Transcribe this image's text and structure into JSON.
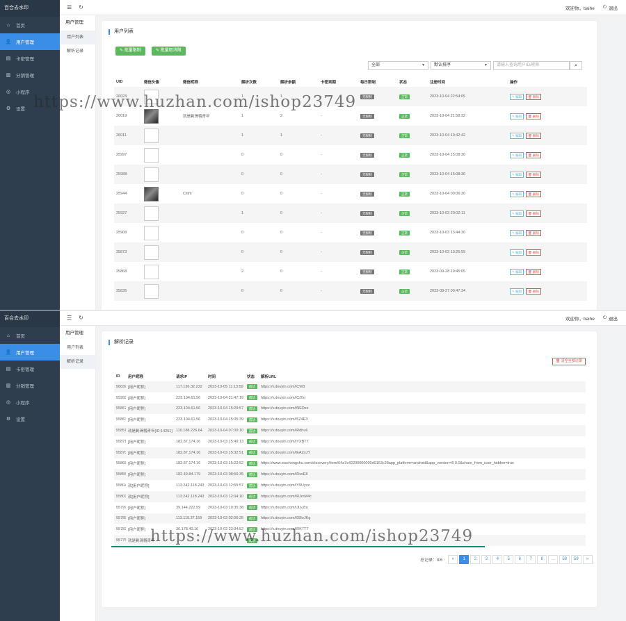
{
  "app": {
    "brand": "百合去水印"
  },
  "sidebar": {
    "items": [
      {
        "label": "首页",
        "icon": "home-icon"
      },
      {
        "label": "用户管理",
        "icon": "user-icon"
      },
      {
        "label": "卡密管理",
        "icon": "card-icon"
      },
      {
        "label": "分销管理",
        "icon": "stats-icon"
      },
      {
        "label": "小程序",
        "icon": "miniapp-icon"
      },
      {
        "label": "设置",
        "icon": "gear-icon"
      }
    ],
    "active": "用户管理"
  },
  "topbar": {
    "welcome": "欢迎你，baihe",
    "logout": "退出"
  },
  "subnav": {
    "title": "用户管理",
    "items": [
      "用户列表",
      "解析记录"
    ]
  },
  "user_list": {
    "title": "用户列表",
    "buttons": {
      "batch_limit": "批量限制",
      "batch_unlimit": "批量取消限"
    },
    "filters": {
      "status_select": "全部",
      "sort_select": "默认排序",
      "search_placeholder": "请输入查询用户ID/昵称",
      "search_icon": "search-icon"
    },
    "columns": [
      "UID",
      "微信头像",
      "微信昵称",
      "解析次数",
      "解析余额",
      "卡密到期",
      "每日限制",
      "状态",
      "注册时间",
      "操作"
    ],
    "rows": [
      {
        "uid": "26023",
        "avatar": "blank",
        "nickname": "",
        "count": "1",
        "balance": "1",
        "card_expire": "-",
        "limit": "无限制",
        "status": "正常",
        "reg": "2023-10-04 22:54:05"
      },
      {
        "uid": "26019",
        "avatar": "photo",
        "nickname": "就是剿滑稽青年",
        "count": "1",
        "balance": "2",
        "card_expire": "-",
        "limit": "无限制",
        "status": "正常",
        "reg": "2023-10-04 21:58:32"
      },
      {
        "uid": "26011",
        "avatar": "blank",
        "nickname": "",
        "count": "1",
        "balance": "1",
        "card_expire": "-",
        "limit": "无限制",
        "status": "正常",
        "reg": "2023-10-04 19:42:42"
      },
      {
        "uid": "25997",
        "avatar": "blank",
        "nickname": "",
        "count": "0",
        "balance": "0",
        "card_expire": "-",
        "limit": "无限制",
        "status": "正常",
        "reg": "2023-10-04 15:08:30"
      },
      {
        "uid": "25988",
        "avatar": "blank",
        "nickname": "",
        "count": "0",
        "balance": "0",
        "card_expire": "-",
        "limit": "无限制",
        "status": "正常",
        "reg": "2023-10-04 15:08:30"
      },
      {
        "uid": "25944",
        "avatar": "photo",
        "nickname": "Citim",
        "count": "0",
        "balance": "0",
        "card_expire": "-",
        "limit": "无限制",
        "status": "正常",
        "reg": "2023-10-04 00:06:30"
      },
      {
        "uid": "25927",
        "avatar": "blank",
        "nickname": "",
        "count": "1",
        "balance": "0",
        "card_expire": "-",
        "limit": "无限制",
        "status": "正常",
        "reg": "2023-10-03 20:02:11"
      },
      {
        "uid": "25908",
        "avatar": "blank",
        "nickname": "",
        "count": "0",
        "balance": "0",
        "card_expire": "-",
        "limit": "无限制",
        "status": "正常",
        "reg": "2023-10-03 13:44:30"
      },
      {
        "uid": "25873",
        "avatar": "blank",
        "nickname": "",
        "count": "0",
        "balance": "0",
        "card_expire": "-",
        "limit": "无限制",
        "status": "正常",
        "reg": "2023-10-03 10:26:59"
      },
      {
        "uid": "25868",
        "avatar": "blank",
        "nickname": "",
        "count": "2",
        "balance": "0",
        "card_expire": "-",
        "limit": "无限制",
        "status": "正常",
        "reg": "2023-09-28 19:45:05"
      },
      {
        "uid": "25835",
        "avatar": "blank",
        "nickname": "",
        "count": "0",
        "balance": "0",
        "card_expire": "-",
        "limit": "无限制",
        "status": "正常",
        "reg": "2023-09-27 00:47:34"
      }
    ],
    "actions": {
      "edit": "编辑",
      "del": "删除"
    }
  },
  "parse_records": {
    "title": "解析记录",
    "clear_button": "清空全部记录",
    "columns": [
      "ID",
      "用户昵称",
      "请求IP",
      "时间",
      "状态",
      "解析URL"
    ],
    "rows": [
      {
        "id": "56039",
        "user": "[用户昵称]",
        "ip": "117.136.32.232",
        "time": "2023-10-05 11:13:59",
        "status": "成功",
        "url": "https://v.douyin.com/iCW3"
      },
      {
        "id": "55993",
        "user": "[用户昵称]",
        "ip": "223.104.61.56",
        "time": "2023-10-04 21:47:19",
        "status": "成功",
        "url": "https://v.douyin.com/iC/2sr"
      },
      {
        "id": "55867",
        "user": "[用户昵称]",
        "ip": "223.104.61.56",
        "time": "2023-10-04 15:29:57",
        "status": "成功",
        "url": "https://v.douyin.com/iNEDxx"
      },
      {
        "id": "55863",
        "user": "[用户昵称]",
        "ip": "223.104.61.56",
        "time": "2023-10-04 15:05:39",
        "status": "成功",
        "url": "https://v.douyin.com/i5Z4E3"
      },
      {
        "id": "55851",
        "user": "就是剿滑稽青年[ID:14251]",
        "ip": "110.188.226.64",
        "time": "2023-10-04 07:00:10",
        "status": "成功",
        "url": "https://v.douyin.com/iRdhu6"
      },
      {
        "id": "55871",
        "user": "[用户昵称]",
        "ip": "182.87.174.16",
        "time": "2023-10-03 15:49:13",
        "status": "成功",
        "url": "https://v.douyin.com/iYXBT7"
      },
      {
        "id": "55870",
        "user": "[用户昵称]",
        "ip": "182.87.174.16",
        "time": "2023-10-03 15:32:51",
        "status": "成功",
        "url": "https://v.douyin.com/iEAZxJY"
      },
      {
        "id": "55868",
        "user": "[用户昵称]",
        "ip": "182.87.174.16",
        "time": "2023-10-03 15:22:52",
        "status": "成功",
        "url": "https://www.xiaohongshu.com/discovery/item/64a7c42200000000d0153c28app_platform=android&app_version=8.0.0&share_from_user_hidden=true"
      },
      {
        "id": "55855",
        "user": "[用户昵称]",
        "ip": "182.49.84.179",
        "time": "2023-10-03 08:56:35",
        "status": "成功",
        "url": "https://v.douyin.com/iRsxE8"
      },
      {
        "id": "55804",
        "user": "就[用户昵称]",
        "ip": "113.242.118.243",
        "time": "2023-10-03 12:55:57",
        "status": "成功",
        "url": "https://v.douyin.com/iY9Uyzz"
      },
      {
        "id": "55803",
        "user": "就[用户昵称]",
        "ip": "113.242.118.243",
        "time": "2023-10-03 12:04:10",
        "status": "成功",
        "url": "https://v.douyin.com/iRJmM4c"
      },
      {
        "id": "55799",
        "user": "[用户昵称]",
        "ip": "39.144.222.59",
        "time": "2023-10-03 10:35:38",
        "status": "成功",
        "url": "https://v.douyin.com/iJLkZtu"
      },
      {
        "id": "55785",
        "user": "[用户昵称]",
        "ip": "113.119.37.159",
        "time": "2023-10-03 02:06:35",
        "status": "成功",
        "url": "https://v.douyin.com/iDBoJKg"
      },
      {
        "id": "55782",
        "user": "[用户昵称]",
        "ip": "36.178.40.16",
        "time": "2023-10-02 23:34:52",
        "status": "成功",
        "url": "https://v.douyin.com/iRK7TT"
      },
      {
        "id": "55775",
        "user": "就是剿滑稽青年",
        "ip": "",
        "time": "",
        "status": "成功",
        "url": ""
      }
    ],
    "pagination": {
      "total_label": "总记录：8/6",
      "prev": "«",
      "pages": [
        "1",
        "2",
        "3",
        "4",
        "5",
        "6",
        "7",
        "8",
        "...",
        "58",
        "59"
      ],
      "next": "»",
      "current": "1"
    }
  },
  "watermark": "https://www.huzhan.com/ishop23749",
  "colors": {
    "sidebar": "#2f3e4e",
    "accent": "#3a8ee6",
    "success": "#5cb85c",
    "danger": "#d9534f",
    "info": "#5bc0de"
  }
}
